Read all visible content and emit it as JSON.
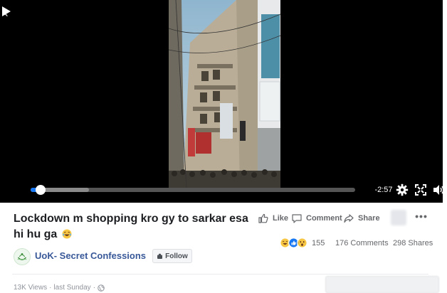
{
  "video": {
    "time_remaining": "-2:57",
    "progress": 0.03,
    "buffered": 0.18
  },
  "post": {
    "title": "Lockdown m shopping kro gy to sarkar esa hi hu ga",
    "title_emoji": "laughing-emoji"
  },
  "actions": {
    "like": "Like",
    "comment": "Comment",
    "share": "Share"
  },
  "stats": {
    "reaction_count": "155",
    "comments": "176 Comments",
    "shares": "298 Shares"
  },
  "page": {
    "name": "UoK- Secret Confessions",
    "follow_label": "Follow"
  },
  "meta": {
    "views": "13K Views",
    "separator": "·",
    "date": "last Sunday",
    "separator2": "·"
  },
  "colors": {
    "accent": "#1877f2",
    "link": "#385898",
    "muted": "#65676b"
  }
}
